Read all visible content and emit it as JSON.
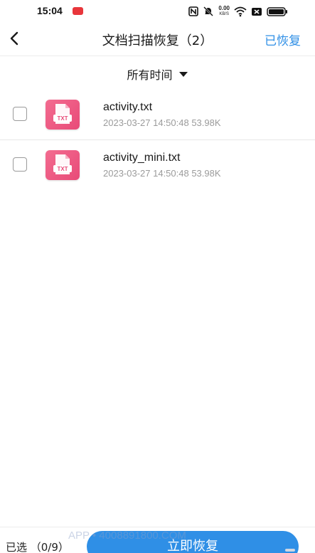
{
  "status_bar": {
    "time": "15:04",
    "net_speed_value": "0.00",
    "net_speed_unit": "KB/S"
  },
  "header": {
    "title": "文档扫描恢复（2）",
    "recovered_label": "已恢复"
  },
  "filter": {
    "time_label": "所有时间"
  },
  "files": [
    {
      "name": "activity.txt",
      "meta": "2023-03-27 14:50:48 53.98K",
      "thumb_label": "TXT"
    },
    {
      "name": "activity_mini.txt",
      "meta": "2023-03-27 14:50:48 53.98K",
      "thumb_label": "TXT"
    }
  ],
  "bottom": {
    "selected_count": "已选 （0/9）",
    "recover_now_label": "立即恢复",
    "watermark": "APP • 4008891800.COM"
  },
  "colors": {
    "accent": "#2f8fe6",
    "file_icon": "#ee5b84"
  }
}
